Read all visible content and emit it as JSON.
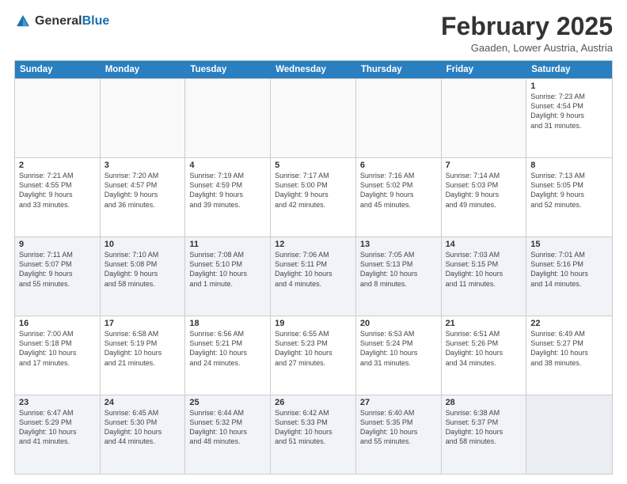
{
  "header": {
    "logo_general": "General",
    "logo_blue": "Blue",
    "month_title": "February 2025",
    "location": "Gaaden, Lower Austria, Austria"
  },
  "weekdays": [
    "Sunday",
    "Monday",
    "Tuesday",
    "Wednesday",
    "Thursday",
    "Friday",
    "Saturday"
  ],
  "rows": [
    {
      "alt": false,
      "cells": [
        {
          "day": "",
          "info": ""
        },
        {
          "day": "",
          "info": ""
        },
        {
          "day": "",
          "info": ""
        },
        {
          "day": "",
          "info": ""
        },
        {
          "day": "",
          "info": ""
        },
        {
          "day": "",
          "info": ""
        },
        {
          "day": "1",
          "info": "Sunrise: 7:23 AM\nSunset: 4:54 PM\nDaylight: 9 hours\nand 31 minutes."
        }
      ]
    },
    {
      "alt": false,
      "cells": [
        {
          "day": "2",
          "info": "Sunrise: 7:21 AM\nSunset: 4:55 PM\nDaylight: 9 hours\nand 33 minutes."
        },
        {
          "day": "3",
          "info": "Sunrise: 7:20 AM\nSunset: 4:57 PM\nDaylight: 9 hours\nand 36 minutes."
        },
        {
          "day": "4",
          "info": "Sunrise: 7:19 AM\nSunset: 4:59 PM\nDaylight: 9 hours\nand 39 minutes."
        },
        {
          "day": "5",
          "info": "Sunrise: 7:17 AM\nSunset: 5:00 PM\nDaylight: 9 hours\nand 42 minutes."
        },
        {
          "day": "6",
          "info": "Sunrise: 7:16 AM\nSunset: 5:02 PM\nDaylight: 9 hours\nand 45 minutes."
        },
        {
          "day": "7",
          "info": "Sunrise: 7:14 AM\nSunset: 5:03 PM\nDaylight: 9 hours\nand 49 minutes."
        },
        {
          "day": "8",
          "info": "Sunrise: 7:13 AM\nSunset: 5:05 PM\nDaylight: 9 hours\nand 52 minutes."
        }
      ]
    },
    {
      "alt": true,
      "cells": [
        {
          "day": "9",
          "info": "Sunrise: 7:11 AM\nSunset: 5:07 PM\nDaylight: 9 hours\nand 55 minutes."
        },
        {
          "day": "10",
          "info": "Sunrise: 7:10 AM\nSunset: 5:08 PM\nDaylight: 9 hours\nand 58 minutes."
        },
        {
          "day": "11",
          "info": "Sunrise: 7:08 AM\nSunset: 5:10 PM\nDaylight: 10 hours\nand 1 minute."
        },
        {
          "day": "12",
          "info": "Sunrise: 7:06 AM\nSunset: 5:11 PM\nDaylight: 10 hours\nand 4 minutes."
        },
        {
          "day": "13",
          "info": "Sunrise: 7:05 AM\nSunset: 5:13 PM\nDaylight: 10 hours\nand 8 minutes."
        },
        {
          "day": "14",
          "info": "Sunrise: 7:03 AM\nSunset: 5:15 PM\nDaylight: 10 hours\nand 11 minutes."
        },
        {
          "day": "15",
          "info": "Sunrise: 7:01 AM\nSunset: 5:16 PM\nDaylight: 10 hours\nand 14 minutes."
        }
      ]
    },
    {
      "alt": false,
      "cells": [
        {
          "day": "16",
          "info": "Sunrise: 7:00 AM\nSunset: 5:18 PM\nDaylight: 10 hours\nand 17 minutes."
        },
        {
          "day": "17",
          "info": "Sunrise: 6:58 AM\nSunset: 5:19 PM\nDaylight: 10 hours\nand 21 minutes."
        },
        {
          "day": "18",
          "info": "Sunrise: 6:56 AM\nSunset: 5:21 PM\nDaylight: 10 hours\nand 24 minutes."
        },
        {
          "day": "19",
          "info": "Sunrise: 6:55 AM\nSunset: 5:23 PM\nDaylight: 10 hours\nand 27 minutes."
        },
        {
          "day": "20",
          "info": "Sunrise: 6:53 AM\nSunset: 5:24 PM\nDaylight: 10 hours\nand 31 minutes."
        },
        {
          "day": "21",
          "info": "Sunrise: 6:51 AM\nSunset: 5:26 PM\nDaylight: 10 hours\nand 34 minutes."
        },
        {
          "day": "22",
          "info": "Sunrise: 6:49 AM\nSunset: 5:27 PM\nDaylight: 10 hours\nand 38 minutes."
        }
      ]
    },
    {
      "alt": true,
      "cells": [
        {
          "day": "23",
          "info": "Sunrise: 6:47 AM\nSunset: 5:29 PM\nDaylight: 10 hours\nand 41 minutes."
        },
        {
          "day": "24",
          "info": "Sunrise: 6:45 AM\nSunset: 5:30 PM\nDaylight: 10 hours\nand 44 minutes."
        },
        {
          "day": "25",
          "info": "Sunrise: 6:44 AM\nSunset: 5:32 PM\nDaylight: 10 hours\nand 48 minutes."
        },
        {
          "day": "26",
          "info": "Sunrise: 6:42 AM\nSunset: 5:33 PM\nDaylight: 10 hours\nand 51 minutes."
        },
        {
          "day": "27",
          "info": "Sunrise: 6:40 AM\nSunset: 5:35 PM\nDaylight: 10 hours\nand 55 minutes."
        },
        {
          "day": "28",
          "info": "Sunrise: 6:38 AM\nSunset: 5:37 PM\nDaylight: 10 hours\nand 58 minutes."
        },
        {
          "day": "",
          "info": ""
        }
      ]
    }
  ]
}
